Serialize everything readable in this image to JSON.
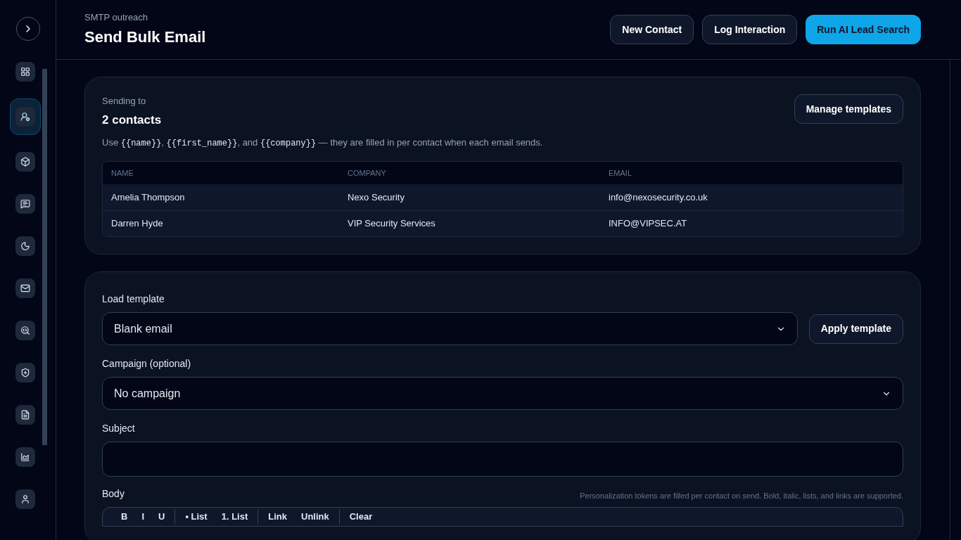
{
  "sidebar": {
    "items": [
      {
        "selected": false
      },
      {
        "selected": true
      },
      {
        "selected": false
      },
      {
        "selected": false
      },
      {
        "selected": false
      },
      {
        "selected": false
      },
      {
        "selected": false
      },
      {
        "selected": false
      },
      {
        "selected": false
      },
      {
        "selected": false
      },
      {
        "selected": false
      }
    ]
  },
  "header": {
    "eyebrow": "SMTP outreach",
    "title": "Send Bulk Email",
    "buttons": [
      {
        "label": "New Contact",
        "kind": "secondary"
      },
      {
        "label": "Log Interaction",
        "kind": "secondary"
      },
      {
        "label": "Run AI Lead Search",
        "kind": "primary"
      }
    ]
  },
  "recipients": {
    "label": "Sending to",
    "count": "2 contacts",
    "manage_button": "Manage templates",
    "hint_parts": [
      {
        "text": "Use ",
        "kind": "text"
      },
      {
        "text": "{{name}}",
        "kind": "code"
      },
      {
        "text": ", ",
        "kind": "text"
      },
      {
        "text": "{{first_name}}",
        "kind": "code"
      },
      {
        "text": ", and ",
        "kind": "text"
      },
      {
        "text": "{{company}}",
        "kind": "code"
      },
      {
        "text": " — they are filled in per contact when each email sends.",
        "kind": "text"
      }
    ],
    "table": {
      "columns": [
        "NAME",
        "COMPANY",
        "EMAIL"
      ],
      "rows": [
        [
          "Amelia Thompson",
          "Nexo Security",
          "info@nexosecurity.co.uk"
        ],
        [
          "Darren Hyde",
          "VIP Security Services",
          "INFO@VIPSEC.AT"
        ]
      ]
    }
  },
  "compose": {
    "template": {
      "label": "Load template",
      "value": "Blank email",
      "button": "Apply template"
    },
    "campaign": {
      "label": "Campaign (optional)",
      "value": "No campaign"
    },
    "subject": {
      "label": "Subject"
    },
    "body": {
      "label": "Body",
      "hint": "Personalization tokens are filled per contact on send. Bold, italic, lists, and links are supported.",
      "toolbar": [
        [
          "B",
          "I",
          "U"
        ],
        [
          "• List",
          "1. List"
        ],
        [
          "Link",
          "Unlink"
        ],
        [
          "Clear"
        ]
      ]
    }
  }
}
